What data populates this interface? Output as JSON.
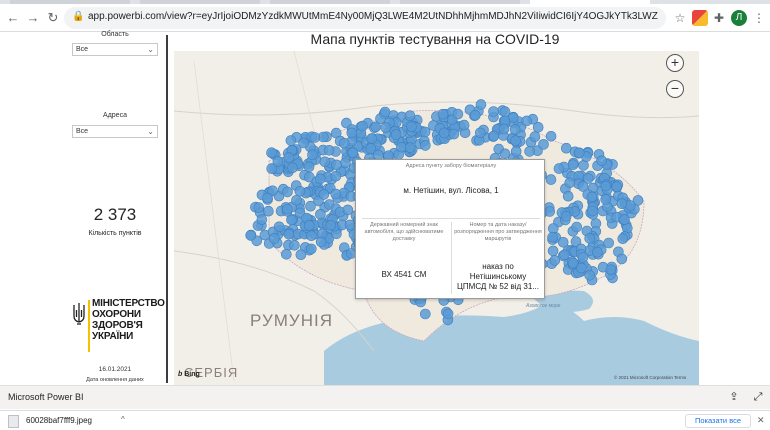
{
  "browser": {
    "url": "app.powerbi.com/view?r=eyJrIjoiODMzYzdkMWUtMmE4Ny00MjQ3LWE4M2UtNDhhMjhmMDJhN2ViIiwidCI6IjY4OGJkYTk3LWZkNWMtNDM2Yy04N2JjLTQ4Y...",
    "avatar_letter": "Л",
    "icons": [
      "back-icon",
      "forward-icon",
      "reload-icon",
      "lock-icon",
      "star-icon",
      "extension-icon",
      "puzzle-icon",
      "menu-icon"
    ]
  },
  "sidebar": {
    "region_label": "Область",
    "region_value": "Все",
    "address_label": "Адреса",
    "address_value": "Все",
    "kpi_value": "2 373",
    "kpi_label": "Кількість пунктів",
    "ministry_lines": [
      "МІНІСТЕРСТВО",
      "ОХОРОНИ",
      "ЗДОРОВ'Я",
      "УКРАЇНИ"
    ],
    "date": "16.01.2021",
    "date_label": "Дата оновлення даних"
  },
  "map": {
    "title": "Мапа пунктів тестування на COVID-19",
    "country_label_1": "РУМУНІЯ",
    "country_label_2": "СЕРБІЯ",
    "sea_label": "Азовское море",
    "bing_label": "Bing",
    "copyright": "© 2021 Microsoft Corporation  Terms",
    "zoom_in": "+",
    "zoom_out": "−",
    "marker_color": "#5b9bd5"
  },
  "tooltip": {
    "header": "Адреса пункту забору біоматеріалу",
    "address": "м. Нетішин, вул. Лісова, 1",
    "col1_label": "Державний номерний знак автомобіля, що здійснюватиме доставку",
    "col1_value": "ВХ 4541 СМ",
    "col2_label": "Номер та дата наказу/розпорядження про затвердження маршрутів",
    "col2_value_lines": [
      "наказ по",
      "Нетішинському",
      "ЦПМСД № 52 від 31..."
    ]
  },
  "pbi_footer": {
    "title": "Microsoft Power BI"
  },
  "downloads": {
    "file_name": "60028baf7fff9.jpeg",
    "show_all": "Показати все"
  }
}
